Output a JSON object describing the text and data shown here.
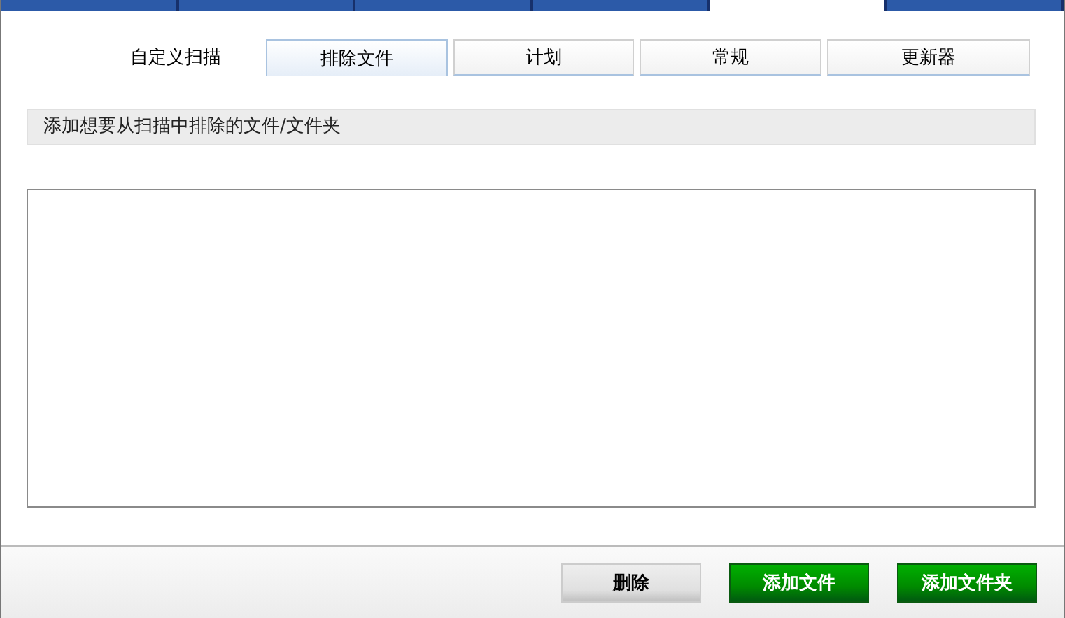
{
  "top_tabs": [
    {
      "selected": false
    },
    {
      "selected": false
    },
    {
      "selected": false
    },
    {
      "selected": false
    },
    {
      "selected": true
    },
    {
      "selected": false
    }
  ],
  "sub_tabs": [
    {
      "label": "自定义扫描",
      "selected": false
    },
    {
      "label": "排除文件",
      "selected": true
    },
    {
      "label": "计划",
      "selected": false
    },
    {
      "label": "常规",
      "selected": false
    },
    {
      "label": "更新器",
      "selected": false
    }
  ],
  "info": "添加想要从扫描中排除的文件/文件夹",
  "buttons": [
    {
      "label": "删除",
      "kind": "plain"
    },
    {
      "label": "添加文件",
      "kind": "primary"
    },
    {
      "label": "添加文件夹",
      "kind": "primary"
    }
  ]
}
